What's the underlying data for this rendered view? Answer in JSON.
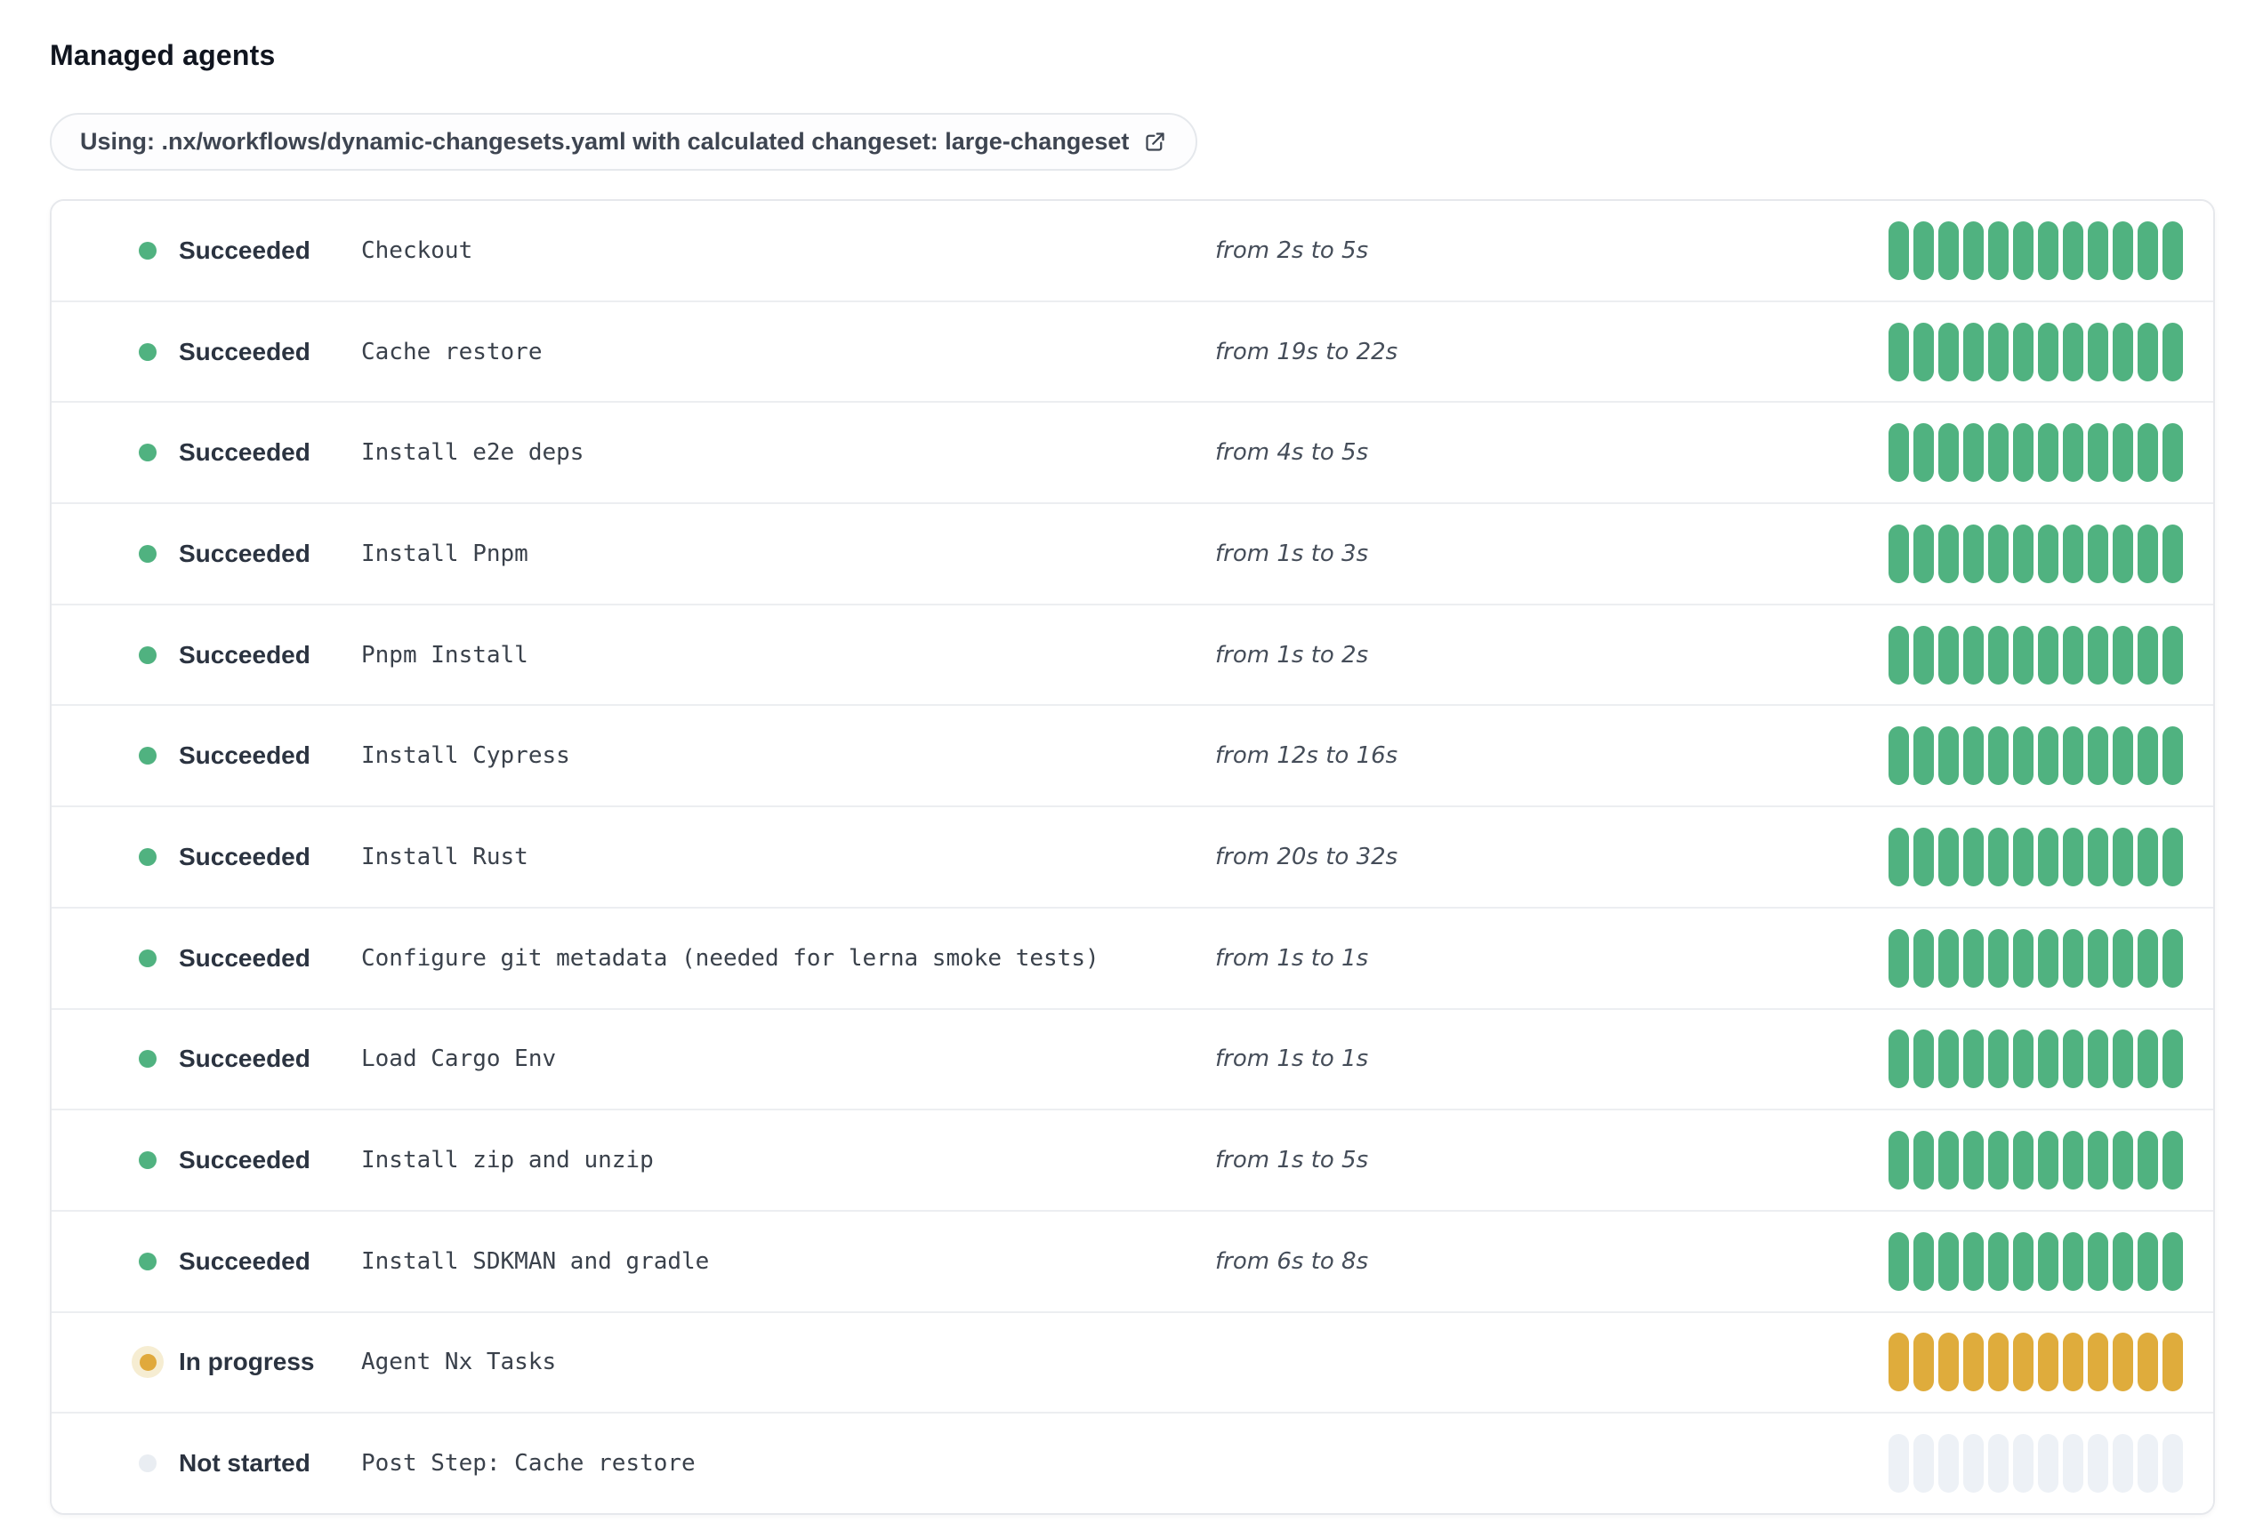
{
  "page": {
    "title": "Managed agents"
  },
  "workflow_banner": {
    "label": "Using: .nx/workflows/dynamic-changesets.yaml with calculated changeset: large-changeset",
    "icon": "external-link-icon"
  },
  "progress_bar": {
    "segments_per_bar": 12
  },
  "colors": {
    "succeeded": "#50b280",
    "in_progress": "#dfac3c",
    "in_progress_halo": "#f6edd2",
    "not_started": "#edf1f6",
    "card_border": "#e6e8ec",
    "row_divider": "#eceef1",
    "title_text": "#10151f",
    "status_text": "#2b3340",
    "step_text": "#3a414b",
    "duration_text": "#454d59"
  },
  "steps": [
    {
      "status": "succeeded",
      "status_label": "Succeeded",
      "name": "Checkout",
      "duration": "from 2s to 5s"
    },
    {
      "status": "succeeded",
      "status_label": "Succeeded",
      "name": "Cache restore",
      "duration": "from 19s to 22s"
    },
    {
      "status": "succeeded",
      "status_label": "Succeeded",
      "name": "Install e2e deps",
      "duration": "from 4s to 5s"
    },
    {
      "status": "succeeded",
      "status_label": "Succeeded",
      "name": "Install Pnpm",
      "duration": "from 1s to 3s"
    },
    {
      "status": "succeeded",
      "status_label": "Succeeded",
      "name": "Pnpm Install",
      "duration": "from 1s to 2s"
    },
    {
      "status": "succeeded",
      "status_label": "Succeeded",
      "name": "Install Cypress",
      "duration": "from 12s to 16s"
    },
    {
      "status": "succeeded",
      "status_label": "Succeeded",
      "name": "Install Rust",
      "duration": "from 20s to 32s"
    },
    {
      "status": "succeeded",
      "status_label": "Succeeded",
      "name": "Configure git metadata (needed for lerna smoke tests)",
      "duration": "from 1s to 1s"
    },
    {
      "status": "succeeded",
      "status_label": "Succeeded",
      "name": "Load Cargo Env",
      "duration": "from 1s to 1s"
    },
    {
      "status": "succeeded",
      "status_label": "Succeeded",
      "name": "Install zip and unzip",
      "duration": "from 1s to 5s"
    },
    {
      "status": "succeeded",
      "status_label": "Succeeded",
      "name": "Install SDKMAN and gradle",
      "duration": "from 6s to 8s"
    },
    {
      "status": "in-progress",
      "status_label": "In progress",
      "name": "Agent Nx Tasks",
      "duration": ""
    },
    {
      "status": "not-started",
      "status_label": "Not started",
      "name": "Post Step: Cache restore",
      "duration": ""
    }
  ]
}
